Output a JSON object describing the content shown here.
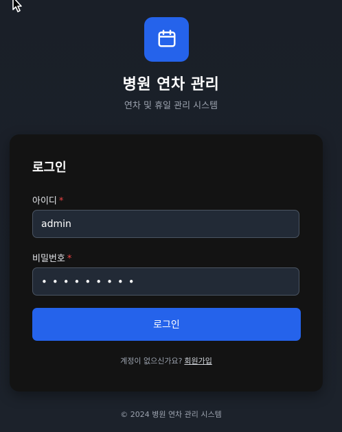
{
  "app": {
    "title": "병원 연차 관리",
    "subtitle": "연차 및 휴일 관리 시스템",
    "logo_icon": "calendar-icon",
    "accent_color": "#2563eb"
  },
  "login": {
    "title": "로그인",
    "username_label": "아이디",
    "username_value": "admin",
    "password_label": "비밀번호",
    "password_value": "•••••••••",
    "required_mark": "*",
    "submit_label": "로그인",
    "signup_prompt": "계정이 없으신가요?",
    "signup_link": "회원가입"
  },
  "footer": {
    "text": "© 2024 병원 연차 관리 시스템"
  },
  "cursor": {
    "icon": "mouse-pointer-icon"
  }
}
